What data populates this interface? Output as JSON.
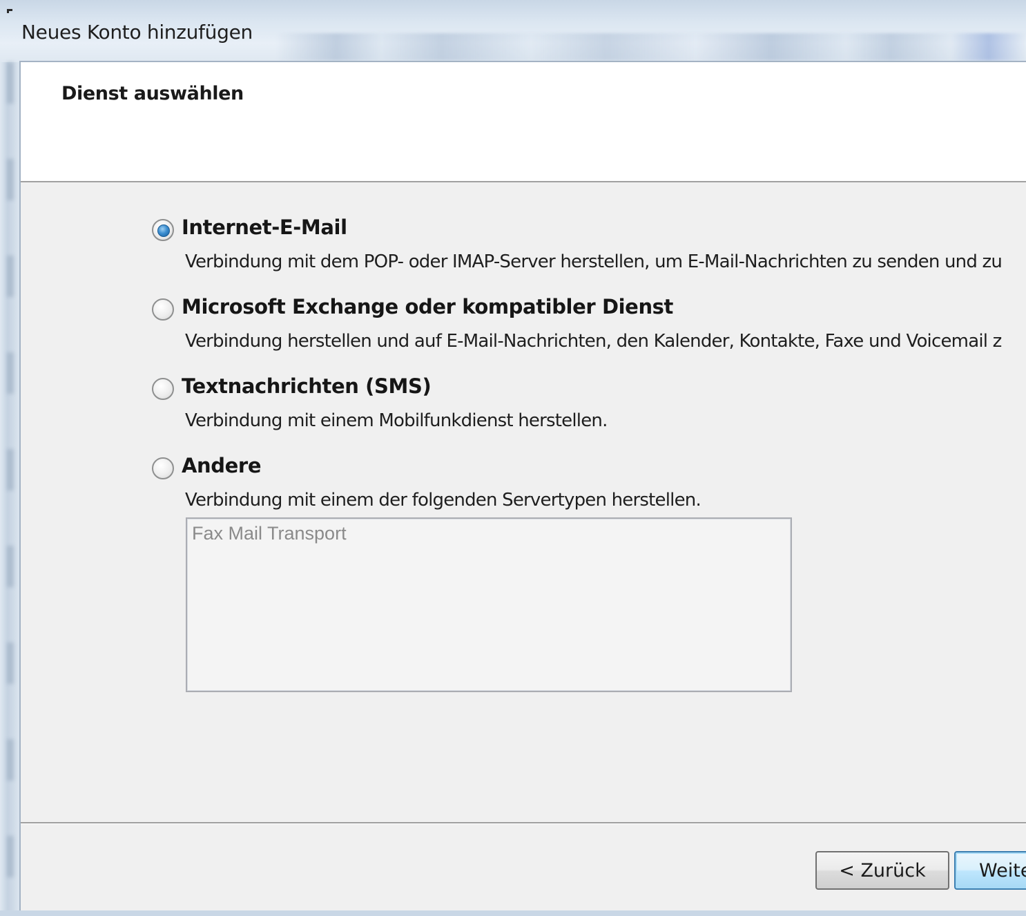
{
  "window": {
    "title": "Neues Konto hinzufügen"
  },
  "header": {
    "title": "Dienst auswählen"
  },
  "options": [
    {
      "label": "Internet-E-Mail",
      "description": "Verbindung mit dem POP- oder IMAP-Server herstellen, um E-Mail-Nachrichten zu senden und zu",
      "checked": true
    },
    {
      "label": "Microsoft Exchange oder kompatibler Dienst",
      "description": "Verbindung herstellen und auf E-Mail-Nachrichten, den Kalender, Kontakte, Faxe und Voicemail z",
      "checked": false
    },
    {
      "label": "Textnachrichten (SMS)",
      "description": "Verbindung mit einem Mobilfunkdienst herstellen.",
      "checked": false
    },
    {
      "label": "Andere",
      "description": "Verbindung mit einem der folgenden Servertypen herstellen.",
      "checked": false
    }
  ],
  "server_types": {
    "items": [
      "Fax Mail Transport"
    ]
  },
  "footer": {
    "back_label": "< Zurück",
    "next_label": "Weiter >"
  },
  "colors": {
    "radio_checked": "#3d8fd1",
    "default_button_border": "#3c7fb1",
    "disabled_text": "#8a8a8a"
  }
}
